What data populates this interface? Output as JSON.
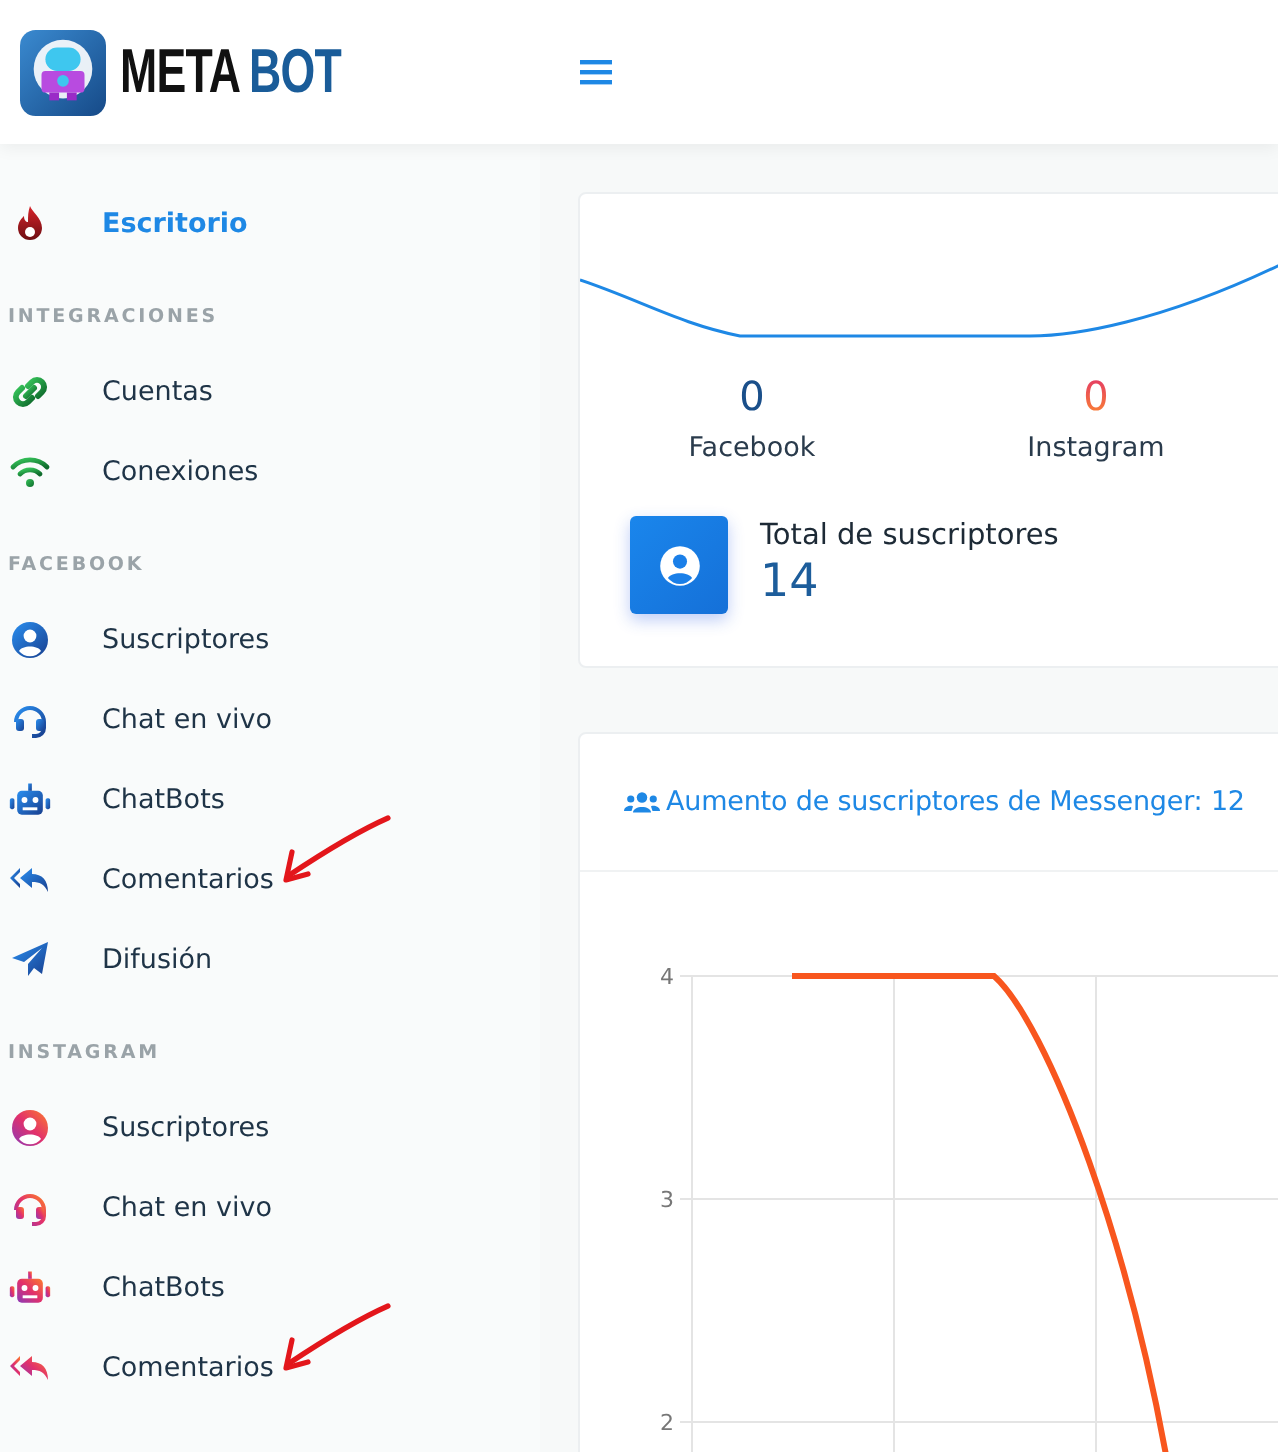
{
  "header": {
    "brand": [
      {
        "kind": "dark",
        "text": "META"
      },
      {
        "kind": "accent",
        "text": "BOT"
      }
    ]
  },
  "sidebar": {
    "sections": [
      {
        "kind": "main",
        "items": [
          {
            "label": "Escritorio",
            "selected": true,
            "annotated": false
          }
        ]
      },
      {
        "kind": "integrations",
        "title": "INTEGRACIONES",
        "items": [
          {
            "label": "Cuentas",
            "selected": false,
            "annotated": false
          },
          {
            "label": "Conexiones",
            "selected": false,
            "annotated": false
          }
        ]
      },
      {
        "kind": "facebook",
        "title": "FACEBOOK",
        "items": [
          {
            "label": "Suscriptores",
            "selected": false,
            "annotated": false
          },
          {
            "label": "Chat en vivo",
            "selected": false,
            "annotated": false
          },
          {
            "label": "ChatBots",
            "selected": false,
            "annotated": false
          },
          {
            "label": "Comentarios",
            "selected": false,
            "annotated": true
          },
          {
            "label": "Difusión",
            "selected": false,
            "annotated": false
          }
        ]
      },
      {
        "kind": "instagram",
        "title": "INSTAGRAM",
        "items": [
          {
            "label": "Suscriptores",
            "selected": false,
            "annotated": false
          },
          {
            "label": "Chat en vivo",
            "selected": false,
            "annotated": false
          },
          {
            "label": "ChatBots",
            "selected": false,
            "annotated": false
          },
          {
            "label": "Comentarios",
            "selected": false,
            "annotated": true
          }
        ]
      }
    ]
  },
  "summary": {
    "stats": [
      {
        "kind": "facebook",
        "value": "0",
        "label": "Facebook"
      },
      {
        "kind": "instagram",
        "value": "0",
        "label": "Instagram"
      }
    ],
    "total": {
      "label": "Total de suscriptores",
      "value": "14"
    }
  },
  "growth": {
    "title": "Aumento de suscriptores de Messenger: 12",
    "y_axis_labels": [
      "4",
      "3",
      "2"
    ]
  }
}
